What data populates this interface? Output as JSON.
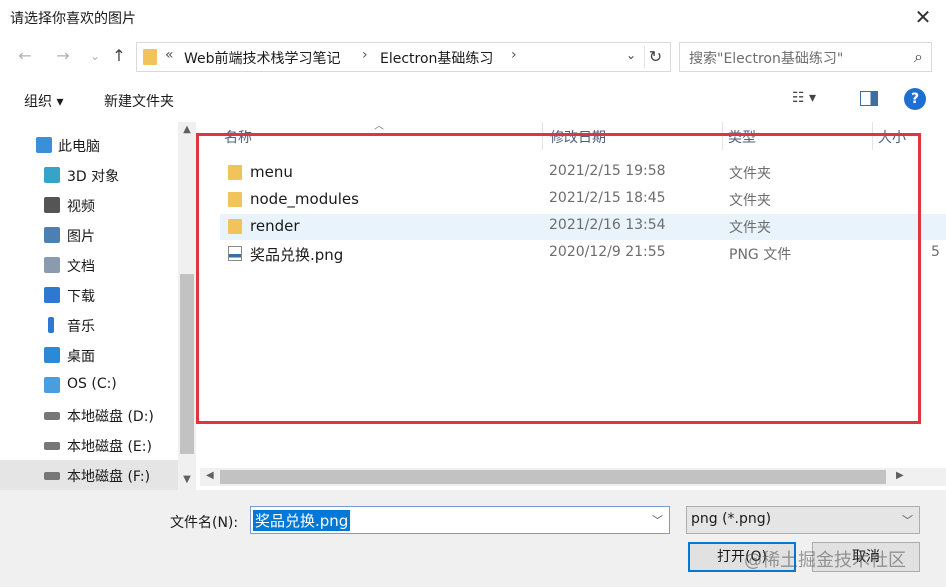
{
  "window": {
    "title": "请选择你喜欢的图片",
    "close_glyph": "✕"
  },
  "nav": {
    "back_glyph": "←",
    "forward_glyph": "→",
    "recent_glyph": "⌄",
    "up_glyph": "↑",
    "breadcrumb": {
      "overflow": "«",
      "items": [
        "Web前端技术栈学习笔记",
        "Electron基础练习"
      ],
      "separator": "›"
    },
    "refresh_glyph": "↻",
    "search_placeholder": "搜索\"Electron基础练习\"",
    "search_glyph": "⌕"
  },
  "toolbar": {
    "organize": "组织 ▾",
    "new_folder": "新建文件夹",
    "view_glyph": "☷ ▾",
    "help": "?"
  },
  "sidebar": {
    "items": [
      {
        "label": "此电脑",
        "icon": "computer-icon",
        "color": "#3a8fd8",
        "root": true
      },
      {
        "label": "3D 对象",
        "icon": "cube-icon",
        "color": "#36a3c9"
      },
      {
        "label": "视频",
        "icon": "film-icon",
        "color": "#555555"
      },
      {
        "label": "图片",
        "icon": "picture-icon",
        "color": "#4c7fb2"
      },
      {
        "label": "文档",
        "icon": "document-icon",
        "color": "#8a9bb0"
      },
      {
        "label": "下载",
        "icon": "download-icon",
        "color": "#2b79d0"
      },
      {
        "label": "音乐",
        "icon": "music-icon",
        "color": "#2b79d0"
      },
      {
        "label": "桌面",
        "icon": "desktop-icon",
        "color": "#2b8ad8"
      },
      {
        "label": "OS (C:)",
        "icon": "windows-drive-icon",
        "color": "#4a9ee0"
      },
      {
        "label": "本地磁盘 (D:)",
        "icon": "drive-icon",
        "color": "#777777"
      },
      {
        "label": "本地磁盘 (E:)",
        "icon": "drive-icon",
        "color": "#777777"
      },
      {
        "label": "本地磁盘 (F:)",
        "icon": "drive-icon",
        "color": "#777777",
        "selected": true
      }
    ]
  },
  "columns": {
    "name": "名称",
    "modified": "修改日期",
    "type": "类型",
    "size": "大小",
    "sort_glyph": "︿"
  },
  "files": [
    {
      "name": "menu",
      "modified": "2021/2/15 19:58",
      "type": "文件夹",
      "size": "",
      "kind": "folder"
    },
    {
      "name": "node_modules",
      "modified": "2021/2/15 18:45",
      "type": "文件夹",
      "size": "",
      "kind": "folder"
    },
    {
      "name": "render",
      "modified": "2021/2/16 13:54",
      "type": "文件夹",
      "size": "",
      "kind": "folder",
      "selected": true
    },
    {
      "name": "奖品兑换.png",
      "modified": "2020/12/9 21:55",
      "type": "PNG 文件",
      "size": "5",
      "kind": "png"
    }
  ],
  "footer": {
    "filename_label": "文件名(N):",
    "filename_value": "奖品兑换.png",
    "filter_value": "png (*.png)",
    "open_button": "打开(O)",
    "cancel_button": "取消"
  },
  "watermark": "@稀土掘金技术社区",
  "colors": {
    "accent": "#0078d7",
    "highlight_box": "#e0353f",
    "folder": "#f0c45a"
  }
}
